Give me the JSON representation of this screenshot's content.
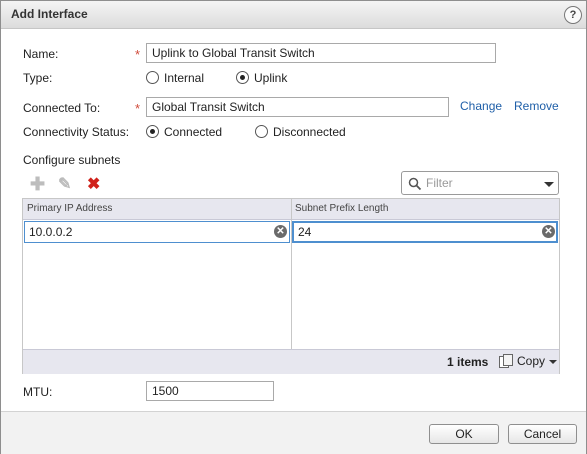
{
  "dialog": {
    "title": "Add Interface",
    "help_icon_text": "?"
  },
  "form": {
    "name_label": "Name:",
    "name_value": "Uplink to Global Transit Switch",
    "type_label": "Type:",
    "type_options": [
      {
        "label": "Internal",
        "selected": false
      },
      {
        "label": "Uplink",
        "selected": true
      }
    ],
    "connected_to_label": "Connected To:",
    "connected_to_value": "Global Transit Switch",
    "change_link": "Change",
    "remove_link": "Remove",
    "connectivity_label": "Connectivity Status:",
    "connectivity_options": [
      {
        "label": "Connected",
        "selected": true
      },
      {
        "label": "Disconnected",
        "selected": false
      }
    ],
    "required_marker": "*"
  },
  "subnets": {
    "section_label": "Configure subnets",
    "toolbar_icons": [
      "add-icon",
      "edit-icon",
      "delete-icon"
    ],
    "filter_placeholder": "Filter",
    "columns": [
      "Primary IP Address",
      "Subnet Prefix Length"
    ],
    "rows": [
      [
        "10.0.0.2",
        "24"
      ]
    ],
    "item_count": "1 items",
    "copy_label": "Copy"
  },
  "mtu": {
    "label": "MTU:",
    "value": "1500"
  },
  "buttons": {
    "ok": "OK",
    "cancel": "Cancel"
  },
  "colors": {
    "link": "#1f5fa8",
    "required": "#d04a3a",
    "delete": "#d0221b",
    "focus": "#4e8fcf"
  }
}
